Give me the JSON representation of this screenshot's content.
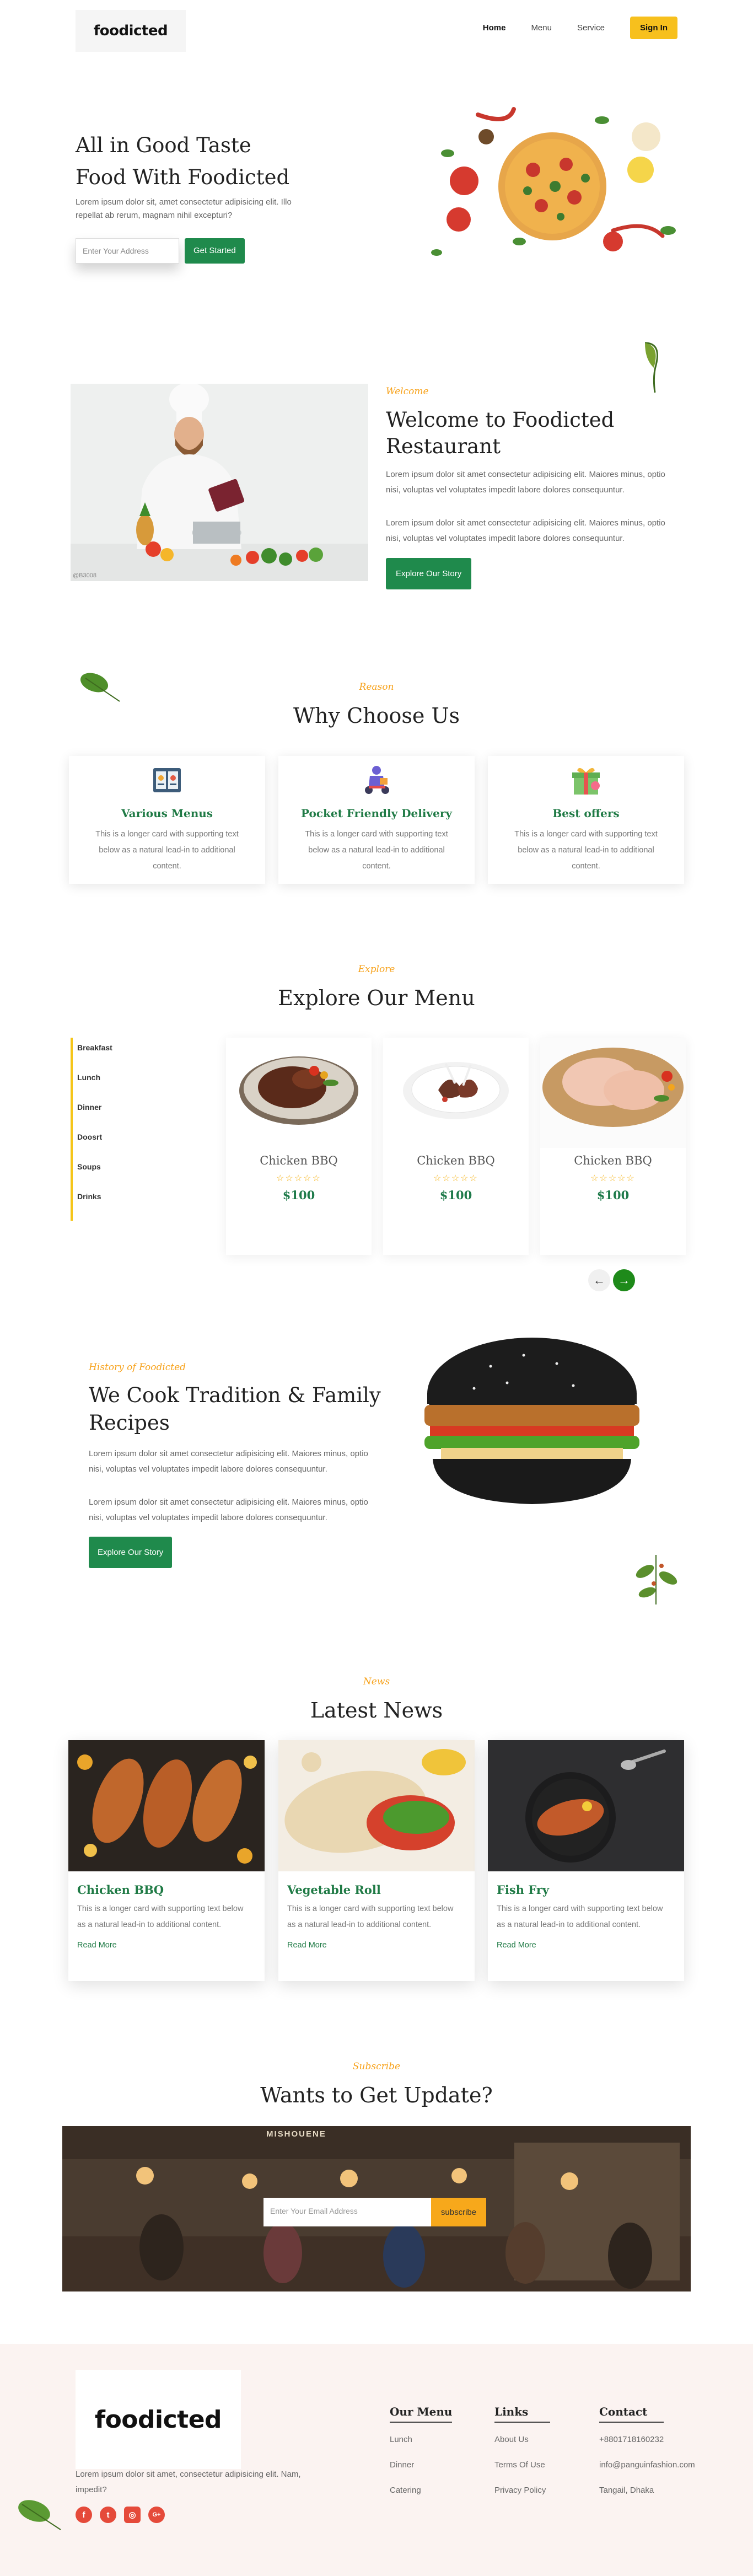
{
  "nav": {
    "logo": "foodicted",
    "items": [
      "Home",
      "Menu",
      "Service"
    ],
    "signin": "Sign In"
  },
  "hero": {
    "title_line1": "All in Good Taste",
    "title_line2": "Food With Foodicted",
    "text": "Lorem ipsum dolor sit, amet consectetur adipisicing elit. Illo repellat ab rerum, magnam nihil excepturi?",
    "input_placeholder": "Enter Your Address",
    "button": "Get Started"
  },
  "welcome": {
    "accent": "Welcome",
    "title": "Welcome to Foodicted Restaurant",
    "para1": "Lorem ipsum dolor sit amet consectetur adipisicing elit. Maiores minus, optio nisi, voluptas vel voluptates impedit labore dolores consequuntur.",
    "para2": "Lorem ipsum dolor sit amet consectetur adipisicing elit. Maiores minus, optio nisi, voluptas vel voluptates impedit labore dolores consequuntur.",
    "button": "Explore Our Story",
    "image_caption": "@B3008"
  },
  "why": {
    "accent": "Reason",
    "title": "Why Choose Us",
    "cards": [
      {
        "title": "Various Menus",
        "text": "This is a longer card with supporting text below as a natural lead-in to additional content.",
        "icon": "menu-book-icon"
      },
      {
        "title": "Pocket Friendly Delivery",
        "text": "This is a longer card with supporting text below as a natural lead-in to additional content.",
        "icon": "delivery-scooter-icon"
      },
      {
        "title": "Best offers",
        "text": "This is a longer card with supporting text below as a natural lead-in to additional content.",
        "icon": "gift-icon"
      }
    ]
  },
  "menu": {
    "accent": "Explore",
    "title": "Explore Our Menu",
    "categories": [
      "Breakfast",
      "Lunch",
      "Dinner",
      "Doosrt",
      "Soups",
      "Drinks"
    ],
    "dishes": [
      {
        "name": "Chicken BBQ",
        "price": "$100",
        "stars": "☆☆☆☆☆"
      },
      {
        "name": "Chicken BBQ",
        "price": "$100",
        "stars": "☆☆☆☆☆"
      },
      {
        "name": "Chicken BBQ",
        "price": "$100",
        "stars": "☆☆☆☆☆"
      }
    ],
    "prev_arrow": "←",
    "next_arrow": "→"
  },
  "history": {
    "accent": "History of Foodicted",
    "title": "We Cook Tradition & Family Recipes",
    "para1": "Lorem ipsum dolor sit amet consectetur adipisicing elit. Maiores minus, optio nisi, voluptas vel voluptates impedit labore dolores consequuntur.",
    "para2": "Lorem ipsum dolor sit amet consectetur adipisicing elit. Maiores minus, optio nisi, voluptas vel voluptates impedit labore dolores consequuntur.",
    "button": "Explore Our Story"
  },
  "news": {
    "accent": "News",
    "title": "Latest News",
    "items": [
      {
        "title": "Chicken BBQ",
        "text": "This is a longer card with supporting text below as a natural lead-in to additional content.",
        "link": "Read More"
      },
      {
        "title": "Vegetable Roll",
        "text": "This is a longer card with supporting text below as a natural lead-in to additional content.",
        "link": "Read More"
      },
      {
        "title": "Fish Fry",
        "text": "This is a longer card with supporting text below as a natural lead-in to additional content.",
        "link": "Read More"
      }
    ]
  },
  "subscribe": {
    "accent": "Subscribe",
    "title": "Wants to Get Update?",
    "input_placeholder": "Enter Your Email Address",
    "button": "subscribe",
    "sign_text": "MISHOUENE"
  },
  "footer": {
    "logo": "foodicted",
    "description": "Lorem ipsum dolor sit amet, consectetur adipisicing elit. Nam, impedit?",
    "social": [
      "f",
      "t",
      "◎",
      "G+"
    ],
    "columns": [
      {
        "heading": "Our Menu",
        "items": [
          "Lunch",
          "Dinner",
          "Catering"
        ]
      },
      {
        "heading": "Links",
        "items": [
          "About Us",
          "Terms Of Use",
          "Privacy Policy"
        ]
      },
      {
        "heading": "Contact",
        "items": [
          "+8801718160232",
          "info@panguinfashion.com",
          "Tangail, Dhaka"
        ]
      }
    ]
  },
  "colors": {
    "primary_green": "#1f8a4c",
    "accent_yellow": "#f7c01d",
    "accent_orange": "#f7a21b",
    "footer_bg": "#fbf3f1"
  }
}
